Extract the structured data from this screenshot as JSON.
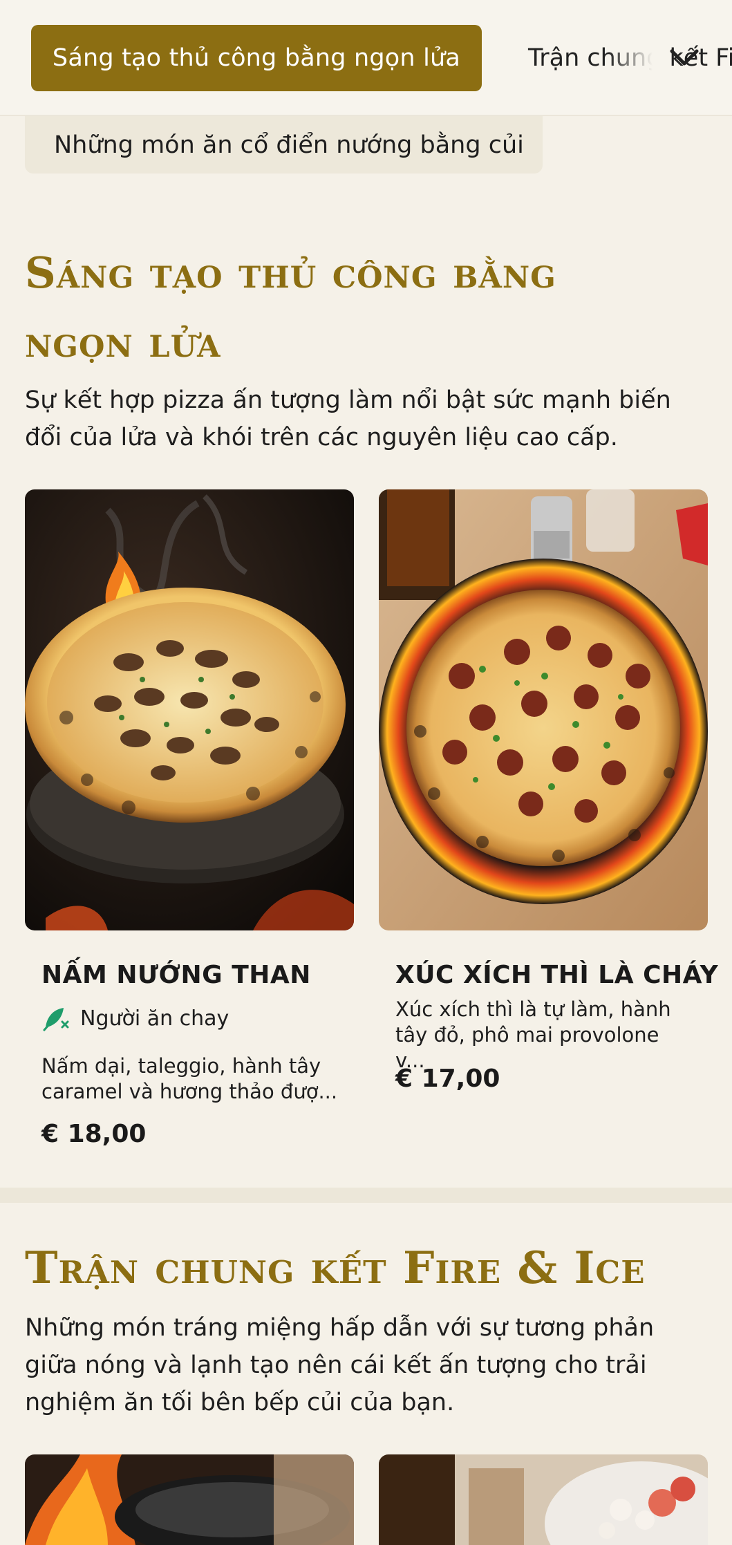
{
  "category_bar": {
    "active_label": "Sáng tạo thủ công bằng ngọn lửa",
    "next_label": "Trận chung kết Fire & Ice",
    "chevron_icon": "chevron-down-icon"
  },
  "previous_section_chip": "Những món ăn cổ điển nướng bằng củi",
  "section_flame": {
    "title_line1": "Sáng tạo thủ công bằng",
    "title_line2": "ngọn lửa",
    "description": "Sự kết hợp pizza ấn tượng làm nổi bật sức mạnh biến đổi của lửa và khói trên các nguyên liệu cao cấp.",
    "items": [
      {
        "name": "NẤM NƯỚNG THAN",
        "tag": "Người ăn chay",
        "tag_icon": "vegetarian-leaf-icon",
        "description": "Nấm dại, taleggio, hành tây caramel và hương thảo đượ...",
        "price": "€ 18,00"
      },
      {
        "name": "XÚC XÍCH THÌ LÀ CHÁY",
        "description": "Xúc xích thì là tự làm, hành tây đỏ, phô mai provolone v...",
        "price": "€ 17,00"
      }
    ]
  },
  "section_fire_ice": {
    "title": "Trận chung kết Fire & Ice",
    "description": "Những món tráng miệng hấp dẫn với sự tương phản giữa nóng và lạnh tạo nên cái kết ấn tượng cho trải nghiệm ăn tối bên bếp củi của bạn."
  },
  "colors": {
    "accent": "#8c6e12",
    "background": "#f5f1e8",
    "veg_icon": "#1f9d6b"
  }
}
